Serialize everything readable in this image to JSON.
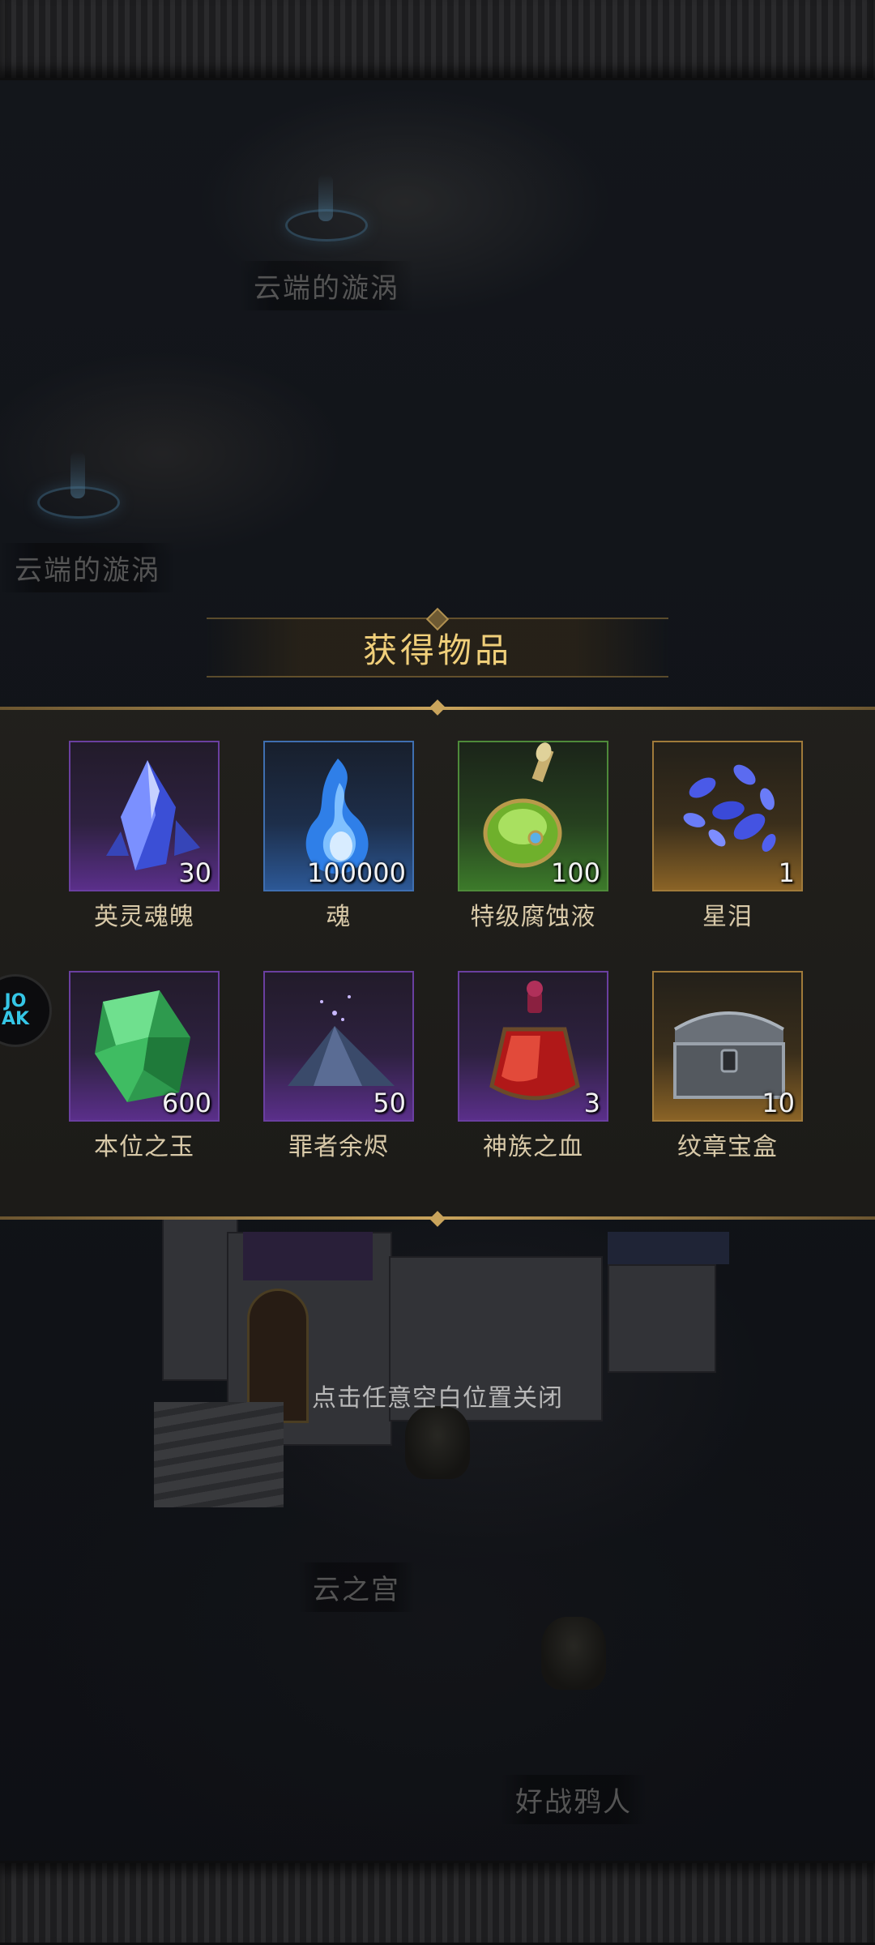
{
  "map": {
    "labels": {
      "vortex_1": "云端的漩涡",
      "vortex_2": "云端的漩涡",
      "palace": "云之宫",
      "harpy": "好战鸦人"
    }
  },
  "popup": {
    "title": "获得物品",
    "items": [
      {
        "name": "英灵魂魄",
        "quantity": "30",
        "rarity": "purple",
        "icon": "blue-crystal-icon"
      },
      {
        "name": "魂",
        "quantity": "100000",
        "rarity": "blue",
        "icon": "blue-soul-flame-icon"
      },
      {
        "name": "特级腐蚀液",
        "quantity": "100",
        "rarity": "green",
        "icon": "green-potion-flask-icon"
      },
      {
        "name": "星泪",
        "quantity": "1",
        "rarity": "gold",
        "icon": "star-tear-shards-icon"
      },
      {
        "name": "本位之玉",
        "quantity": "600",
        "rarity": "purple",
        "icon": "green-jade-gem-icon"
      },
      {
        "name": "罪者余烬",
        "quantity": "50",
        "rarity": "purple",
        "icon": "ember-ash-pile-icon"
      },
      {
        "name": "神族之血",
        "quantity": "3",
        "rarity": "purple",
        "icon": "red-blood-vial-icon"
      },
      {
        "name": "纹章宝盒",
        "quantity": "10",
        "rarity": "gold",
        "icon": "ornate-chest-icon"
      }
    ],
    "close_hint": "点击任意空白位置关闭"
  },
  "side_badge": {
    "text": "JO\nAK"
  },
  "colors": {
    "title": "#f0cf7a",
    "frame_gold": "#c9a45c",
    "purple": "#5a2f8a",
    "blue": "#2c5896",
    "green": "#3c7a2a",
    "gold": "#8a6326"
  }
}
